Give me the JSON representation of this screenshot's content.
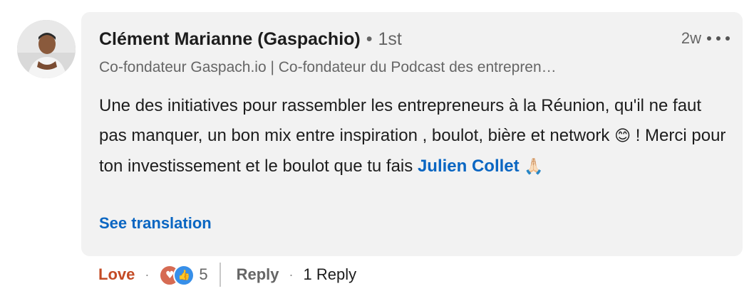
{
  "author": {
    "name": "Clément Marianne (Gaspachio)",
    "separator": "•",
    "degree": "1st",
    "headline": "Co-fondateur Gaspach.io | Co-fondateur du Podcast des entrepren…"
  },
  "meta": {
    "time": "2w"
  },
  "comment": {
    "text_part1": "Une des initiatives pour rassembler les entrepreneurs à la Réunion, qu'il ne faut pas manquer, un bon mix entre inspiration , boulot, bière et network ",
    "emoji_smile": "😊",
    "text_part2": " ! Merci pour ton investissement et le boulot que tu fais ",
    "mention": "Julien Collet",
    "emoji_pray": "🙏🏻",
    "see_translation": "See translation"
  },
  "actions": {
    "love_label": "Love",
    "dot": "·",
    "reaction_count": "5",
    "reply_label": "Reply",
    "reply_dot": "·",
    "reply_count": "1 Reply"
  },
  "icons": {
    "reactions": [
      "love-icon",
      "like-icon"
    ],
    "more": "more-horizontal-icon"
  },
  "colors": {
    "bubble_bg": "#f2f2f2",
    "link": "#0a66c2",
    "love": "#c44b25",
    "like_icon": "#378fe9",
    "love_icon": "#d66b53"
  }
}
